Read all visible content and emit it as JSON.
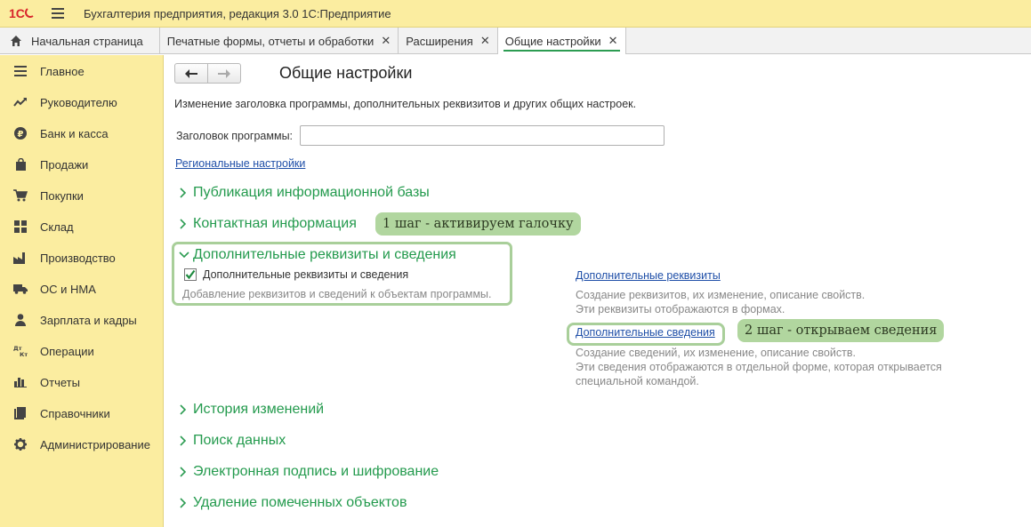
{
  "app": {
    "title": "Бухгалтерия предприятия, редакция 3.0 1С:Предприятие",
    "accent_color": "#239a4d",
    "panel_color": "#fbeda0"
  },
  "tabs": [
    {
      "label": "Начальная страница",
      "icon": "home-icon"
    },
    {
      "label": "Печатные формы, отчеты и обработки",
      "closable": true
    },
    {
      "label": "Расширения",
      "closable": true
    },
    {
      "label": "Общие настройки",
      "closable": true,
      "active": true
    }
  ],
  "sidebar": {
    "items": [
      {
        "label": "Главное",
        "icon": "menu-lines-icon"
      },
      {
        "label": "Руководителю",
        "icon": "trend-chart-icon"
      },
      {
        "label": "Банк и касса",
        "icon": "ruble-coin-icon"
      },
      {
        "label": "Продажи",
        "icon": "shopping-bag-icon"
      },
      {
        "label": "Покупки",
        "icon": "shopping-cart-icon"
      },
      {
        "label": "Склад",
        "icon": "warehouse-boxes-icon"
      },
      {
        "label": "Производство",
        "icon": "factory-icon"
      },
      {
        "label": "ОС и НМА",
        "icon": "truck-icon"
      },
      {
        "label": "Зарплата и кадры",
        "icon": "person-icon"
      },
      {
        "label": "Операции",
        "icon": "debit-credit-icon",
        "glyph_top": "Дт",
        "glyph_bottom": "Кт"
      },
      {
        "label": "Отчеты",
        "icon": "bar-chart-icon"
      },
      {
        "label": "Справочники",
        "icon": "books-icon"
      },
      {
        "label": "Администрирование",
        "icon": "gear-icon"
      }
    ]
  },
  "main": {
    "nav": {
      "back": "🡐",
      "forward": "🡒"
    },
    "page_title": "Общие настройки",
    "description": "Изменение заголовка программы, дополнительных реквизитов и других общих настроек.",
    "program_title_label": "Заголовок программы:",
    "program_title_value": "",
    "regional_link": "Региональные настройки",
    "sections": {
      "publication": "Публикация информационной базы",
      "contact_info": "Контактная информация",
      "additional": "Дополнительные реквизиты и сведения",
      "history": "История изменений",
      "search": "Поиск данных",
      "signature": "Электронная подпись и шифрование",
      "deletion": "Удаление помеченных объектов"
    },
    "additional_block": {
      "checkbox_label": "Дополнительные реквизиты и сведения",
      "checkbox_checked": true,
      "checkbox_hint": "Добавление реквизитов и сведений к объектам программы.",
      "attributes_link": "Дополнительные реквизиты",
      "attributes_hint_1": "Создание реквизитов, их изменение, описание свойств.",
      "attributes_hint_2": "Эти реквизиты отображаются в формах.",
      "info_link": "Дополнительные сведения",
      "info_hint_1": "Создание сведений, их изменение, описание свойств.",
      "info_hint_2": "Эти сведения отображаются в отдельной форме, которая открывается",
      "info_hint_3": "специальной командой."
    },
    "callouts": {
      "step1": "1 шаг - активируем галочку",
      "step2": "2 шаг - открываем сведения"
    }
  }
}
